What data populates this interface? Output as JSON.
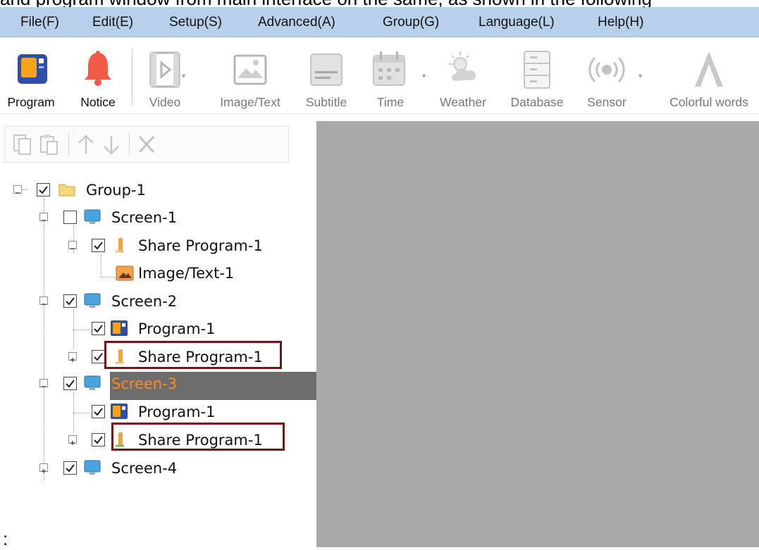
{
  "doc_text": "and program window from main interface on the same, as shown in the following",
  "menu": [
    {
      "label": "File(F)"
    },
    {
      "label": "Edit(E)"
    },
    {
      "label": "Setup(S)"
    },
    {
      "label": "Advanced(A)"
    },
    {
      "label": "Group(G)"
    },
    {
      "label": "Language(L)"
    },
    {
      "label": "Help(H)"
    }
  ],
  "toolbar": {
    "program": "Program",
    "notice": "Notice",
    "video": "Video",
    "image_text": "Image/Text",
    "subtitle": "Subtitle",
    "time": "Time",
    "weather": "Weather",
    "database": "Database",
    "sensor": "Sensor",
    "colorful_words": "Colorful words"
  },
  "tree": {
    "group": "Group-1",
    "screen1": "Screen-1",
    "screen1_share": "Share Program-1",
    "screen1_image": "Image/Text-1",
    "screen2": "Screen-2",
    "screen2_program": "Program-1",
    "screen2_share": "Share Program-1",
    "screen3": "Screen-3",
    "screen3_program": "Program-1",
    "screen3_share": "Share Program-1",
    "screen4": "Screen-4"
  },
  "bottom_text": ":",
  "colors": {
    "menubar": "#b8d0ea",
    "preview": "#a9a9a9",
    "selected_row": "#6d6d6d",
    "selected_text": "#ff8a1f",
    "highlight_box": "#7a1114"
  }
}
